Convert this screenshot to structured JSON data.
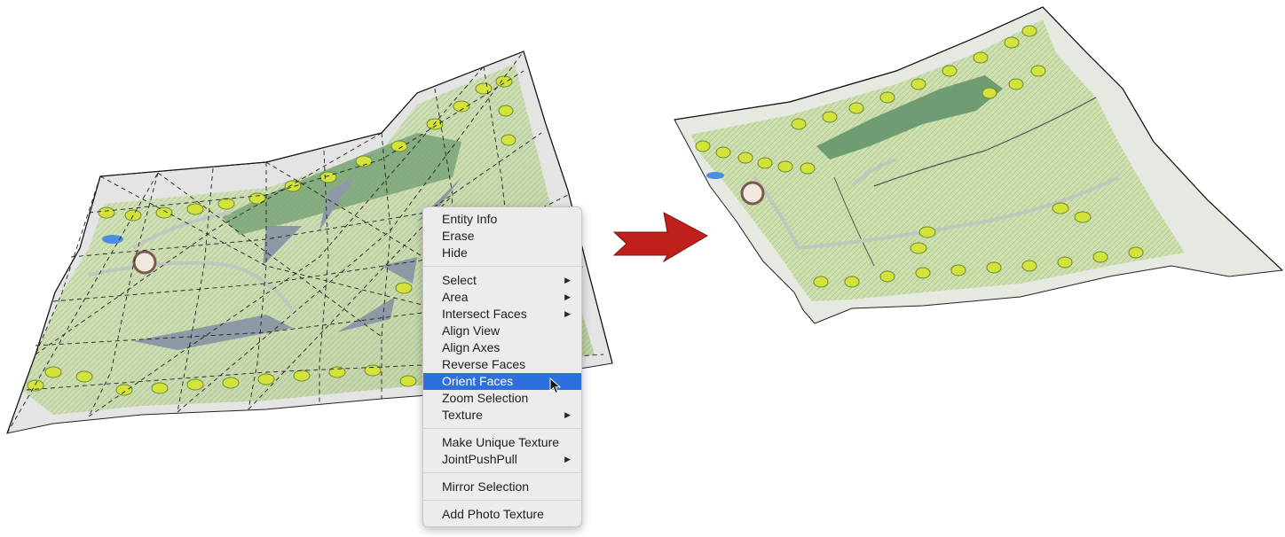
{
  "context_menu": {
    "groups": [
      [
        {
          "label": "Entity Info"
        },
        {
          "label": "Erase"
        },
        {
          "label": "Hide"
        }
      ],
      [
        {
          "label": "Select",
          "submenu": true
        },
        {
          "label": "Area",
          "submenu": true
        },
        {
          "label": "Intersect Faces",
          "submenu": true
        },
        {
          "label": "Align View"
        },
        {
          "label": "Align Axes"
        },
        {
          "label": "Reverse Faces"
        },
        {
          "label": "Orient Faces",
          "highlighted": true
        },
        {
          "label": "Zoom Selection"
        },
        {
          "label": "Texture",
          "submenu": true
        }
      ],
      [
        {
          "label": "Make Unique Texture"
        },
        {
          "label": "JointPushPull",
          "submenu": true
        }
      ],
      [
        {
          "label": "Mirror Selection"
        }
      ],
      [
        {
          "label": "Add Photo Texture"
        }
      ]
    ]
  },
  "colors": {
    "highlight": "#2e6fe0",
    "arrow": "#c0201c",
    "lawn": "#cfe0b0",
    "tree": "#d4e23c",
    "forest": "#6f9c72"
  },
  "icons": {
    "submenu": "triangle-right",
    "cursor": "arrow-pointer"
  }
}
